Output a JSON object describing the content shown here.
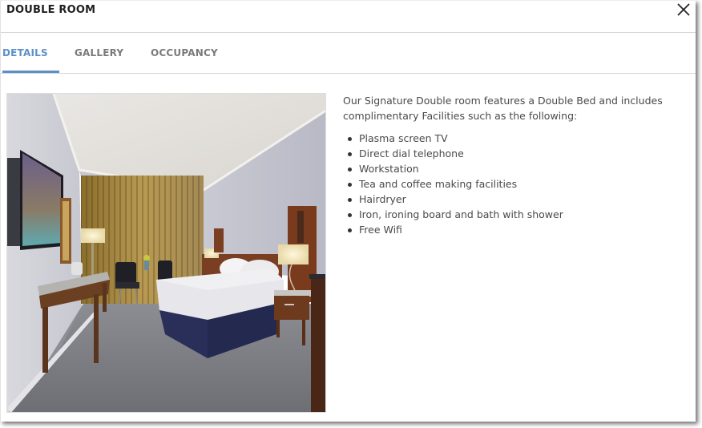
{
  "dialog": {
    "title": "DOUBLE ROOM",
    "close_icon": "close-x-icon"
  },
  "tabs": [
    {
      "label": "DETAILS",
      "active": true
    },
    {
      "label": "GALLERY",
      "active": false
    },
    {
      "label": "OCCUPANCY",
      "active": false
    }
  ],
  "details": {
    "image_alt": "Double room with double bed, wall-mounted TV, desk, chairs and bedside lamps",
    "intro": "Our Signature Double room features a Double Bed and includes complimentary Facilities such as the following:",
    "facilities": [
      "Plasma screen TV",
      "Direct dial telephone",
      "Workstation",
      "Tea and coffee making facilities",
      "Hairdryer",
      "Iron, ironing board and bath with shower",
      "Free Wifi"
    ]
  },
  "colors": {
    "accent": "#5b90c6",
    "tab_inactive": "#7a7a7a",
    "title": "#1f1f1f",
    "body_text": "#4a4a4a"
  }
}
